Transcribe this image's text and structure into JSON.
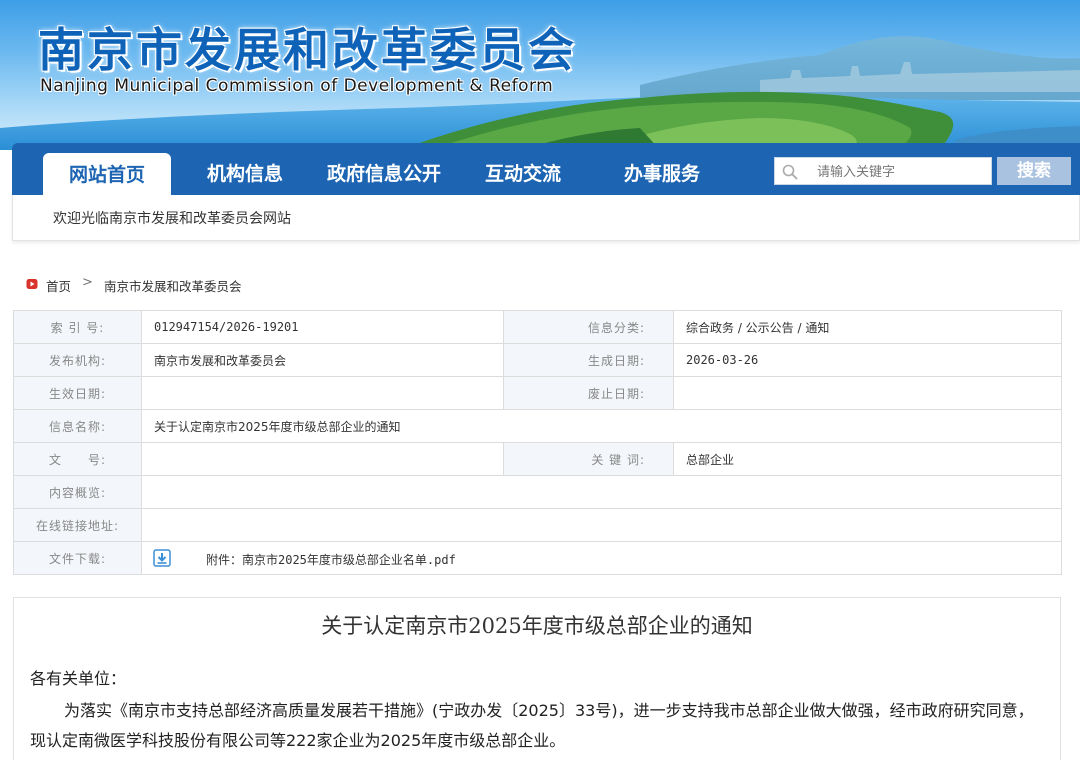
{
  "header": {
    "title_cn": "南京市发展和改革委员会",
    "title_en": "Nanjing Municipal Commission of Development & Reform"
  },
  "nav": {
    "items": [
      {
        "label": "网站首页",
        "active": true
      },
      {
        "label": "机构信息",
        "active": false
      },
      {
        "label": "政府信息公开",
        "active": false
      },
      {
        "label": "互动交流",
        "active": false
      },
      {
        "label": "办事服务",
        "active": false
      }
    ],
    "search": {
      "placeholder": "请输入关键字",
      "button_label": "搜索",
      "icon": "search-icon"
    }
  },
  "welcome": "欢迎光临南京市发展和改革委员会网站",
  "breadcrumb": {
    "home": "首页",
    "separator": ">",
    "current": "南京市发展和改革委员会",
    "icon": "home-icon"
  },
  "meta": {
    "index_label": "索 引 号:",
    "index_value": "012947154/2026-19201",
    "category_label": "信息分类:",
    "category_value": "综合政务 / 公示公告 / 通知",
    "publisher_label": "发布机构:",
    "publisher_value": "南京市发展和改革委员会",
    "created_label": "生成日期:",
    "created_value": "2026-03-26",
    "effective_label": "生效日期:",
    "effective_value": "",
    "expired_label": "废止日期:",
    "expired_value": "",
    "name_label": "信息名称:",
    "name_value": "关于认定南京市2025年度市级总部企业的通知",
    "doc_no_label": "文　　号:",
    "doc_no_value": "",
    "keywords_label": "关 键 词:",
    "keywords_value": "总部企业",
    "summary_label": "内容概览:",
    "summary_value": "",
    "link_label": "在线链接地址:",
    "link_value": "",
    "download_label": "文件下载:",
    "download_value": "附件：南京市2025年度市级总部企业名单.pdf",
    "download_icon": "download-icon"
  },
  "article": {
    "title": "关于认定南京市2025年度市级总部企业的通知",
    "salutation": "各有关单位：",
    "body": "为落实《南京市支持总部经济高质量发展若干措施》(宁政办发〔2025〕33号)，进一步支持我市总部企业做大做强，经市政府研究同意，现认定南微医学科技股份有限公司等222家企业为2025年度市级总部企业。"
  },
  "colors": {
    "nav_blue": "#1d65b3",
    "title_blue": "#0e63b8",
    "label_bg": "#f3f6fa",
    "search_button": "#a9c2df"
  }
}
